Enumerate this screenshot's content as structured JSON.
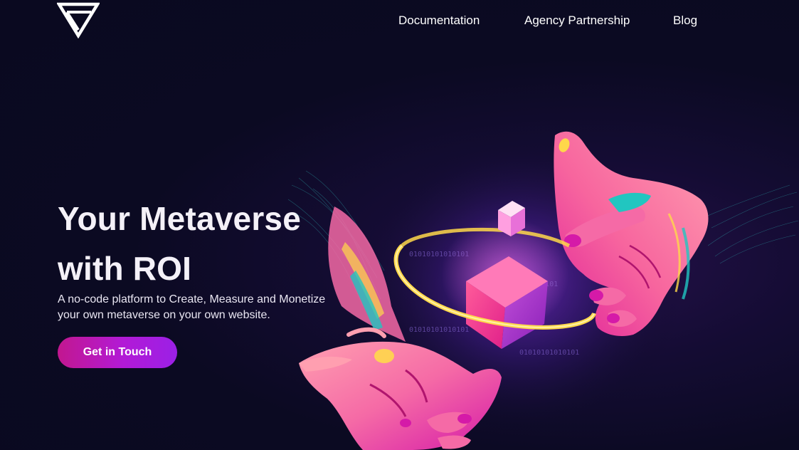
{
  "brand": {
    "logo_icon": "triangle-v-logo-icon"
  },
  "nav": {
    "items": [
      {
        "label": "Documentation"
      },
      {
        "label": "Agency Partnership"
      },
      {
        "label": "Blog"
      }
    ]
  },
  "hero": {
    "title_line1": "Your Metaverse",
    "title_line2": "with ROI",
    "subtitle_line1": "A no-code platform to Create, Measure and Monetize",
    "subtitle_line2": "your own metaverse on your own website.",
    "cta_label": "Get in Touch"
  },
  "illustration": {
    "binary_text": "01010101010101",
    "subject": "hands-holding-glowing-cube-illustration"
  },
  "colors": {
    "background": "#0b0a22",
    "text": "#ffffff",
    "cta_start": "#c2178f",
    "cta_end": "#9b20e6",
    "hand_pink": "#f56aa6",
    "ring_yellow": "#ffd84a",
    "accent_teal": "#21c6c0",
    "accent_magenta": "#d51aa8"
  }
}
